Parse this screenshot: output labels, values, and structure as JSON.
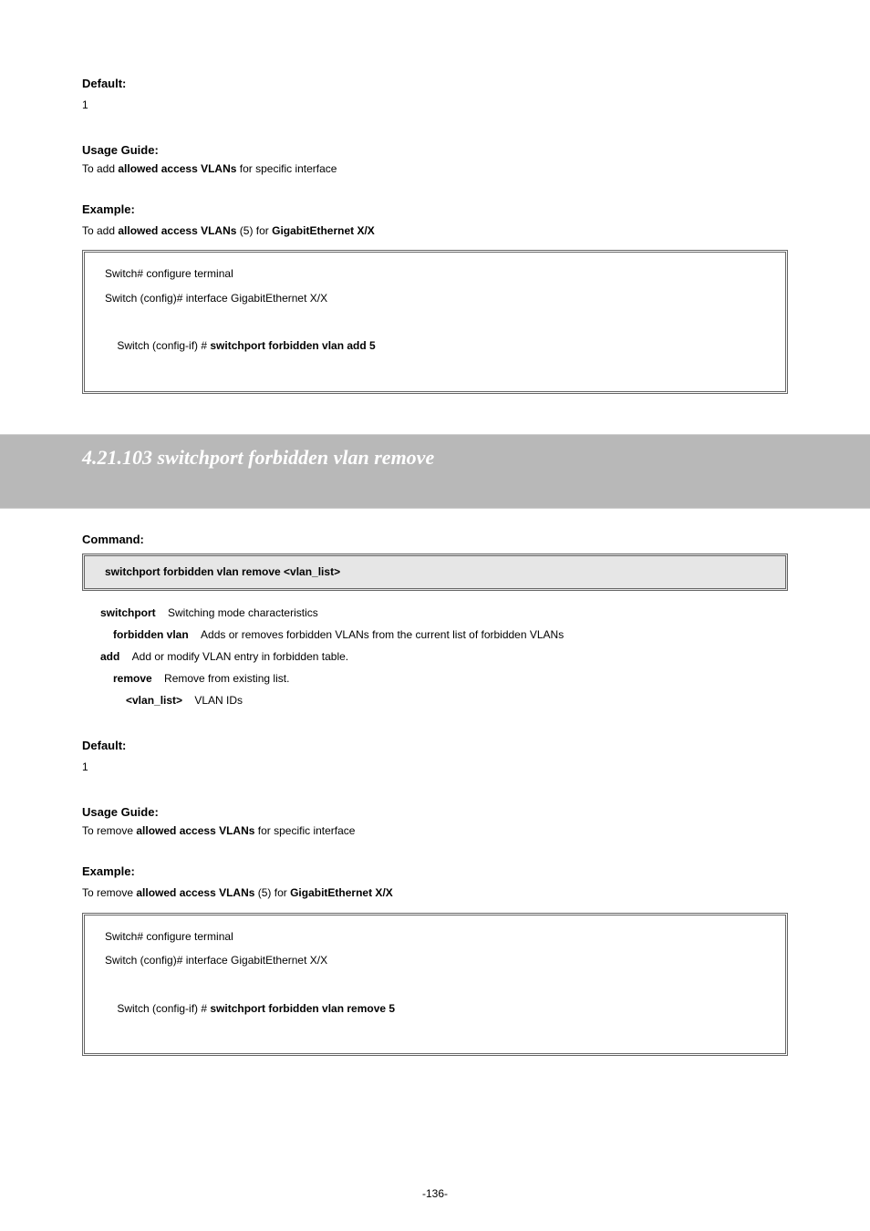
{
  "section1": {
    "default_heading": "Default:",
    "default_value": "1",
    "usage_heading": "Usage Guide:",
    "usage_text_prefix": "To add ",
    "usage_text_bold": "allowed access VLANs",
    "usage_text_suffix": " for specific interface",
    "example_heading": "Example:",
    "example_prefix": "To add ",
    "example_bold": "allowed access VLANs",
    "example_mid": " (5) for ",
    "example_bold2": "GigabitEthernet X/X",
    "code": {
      "l1": "Switch# configure terminal",
      "l2": "Switch (config)# interface GigabitEthernet X/X",
      "l3_prefix": "Switch (config-if) # ",
      "l3_bold": "switchport forbidden vlan add 5"
    }
  },
  "big_heading": "4.21.103 switchport forbidden vlan remove",
  "section2": {
    "command_heading": "Command:",
    "syntax": "switchport forbidden vlan remove <vlan_list>",
    "params": {
      "switchport": "Switching mode characteristics",
      "forbidden_vlan": "Adds or removes forbidden VLANs from the current list of forbidden VLANs",
      "add": "Add or modify VLAN entry in forbidden table.",
      "remove": "Remove from existing list.",
      "vlan_list": "VLAN IDs"
    },
    "default_heading": "Default:",
    "default_value": "1",
    "usage_heading": "Usage Guide:",
    "usage_text_prefix": "To remove ",
    "usage_text_bold": "allowed access VLANs",
    "usage_text_suffix": " for specific interface",
    "example_heading": "Example:",
    "example_prefix": "To remove ",
    "example_bold": "allowed access VLANs",
    "example_mid": " (5) for ",
    "example_bold2": "GigabitEthernet X/X",
    "code": {
      "l1": "Switch# configure terminal",
      "l2": "Switch (config)# interface GigabitEthernet X/X",
      "l3_prefix": "Switch (config-if) # ",
      "l3_bold": "switchport forbidden vlan remove 5"
    }
  },
  "page_number": "-136-"
}
